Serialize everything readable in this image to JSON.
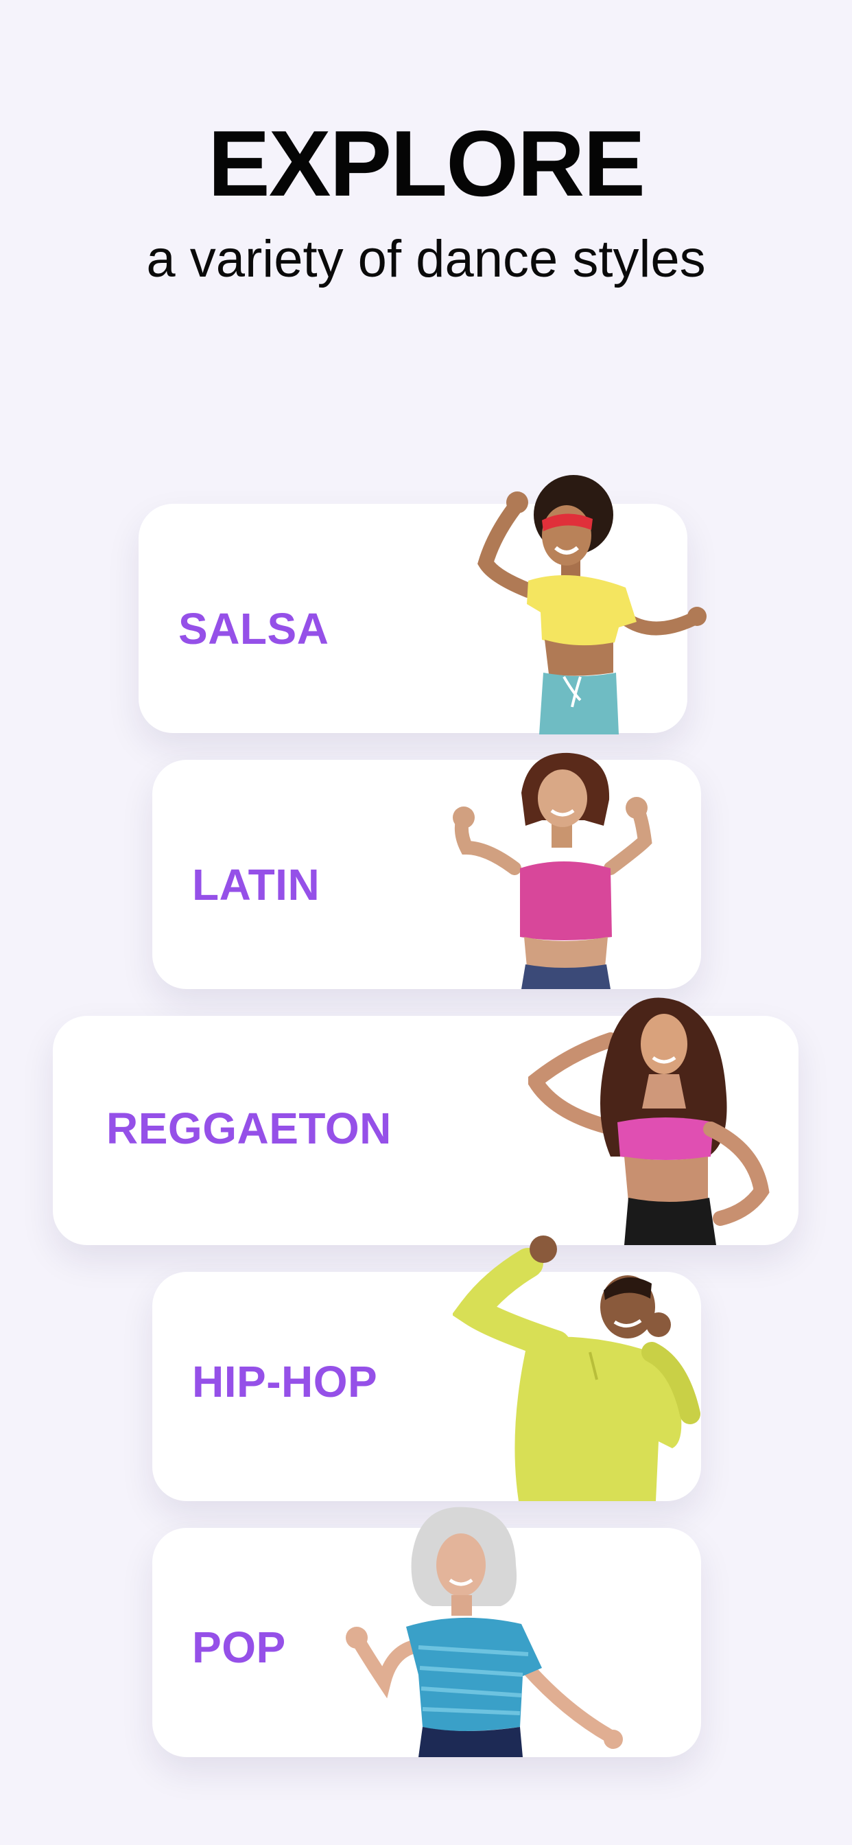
{
  "header": {
    "title": "EXPLORE",
    "subtitle": "a variety of dance styles"
  },
  "dance_styles": [
    {
      "label": "SALSA",
      "illustration": "salsa-dancer-illustration"
    },
    {
      "label": "LATIN",
      "illustration": "latin-dancer-illustration"
    },
    {
      "label": "REGGAETON",
      "illustration": "reggaeton-dancer-illustration"
    },
    {
      "label": "HIP-HOP",
      "illustration": "hiphop-dancer-illustration"
    },
    {
      "label": "POP",
      "illustration": "pop-dancer-illustration"
    }
  ],
  "colors": {
    "background": "#f5f3fb",
    "card": "#ffffff",
    "accent": "#9550e8",
    "heading": "#050505"
  }
}
